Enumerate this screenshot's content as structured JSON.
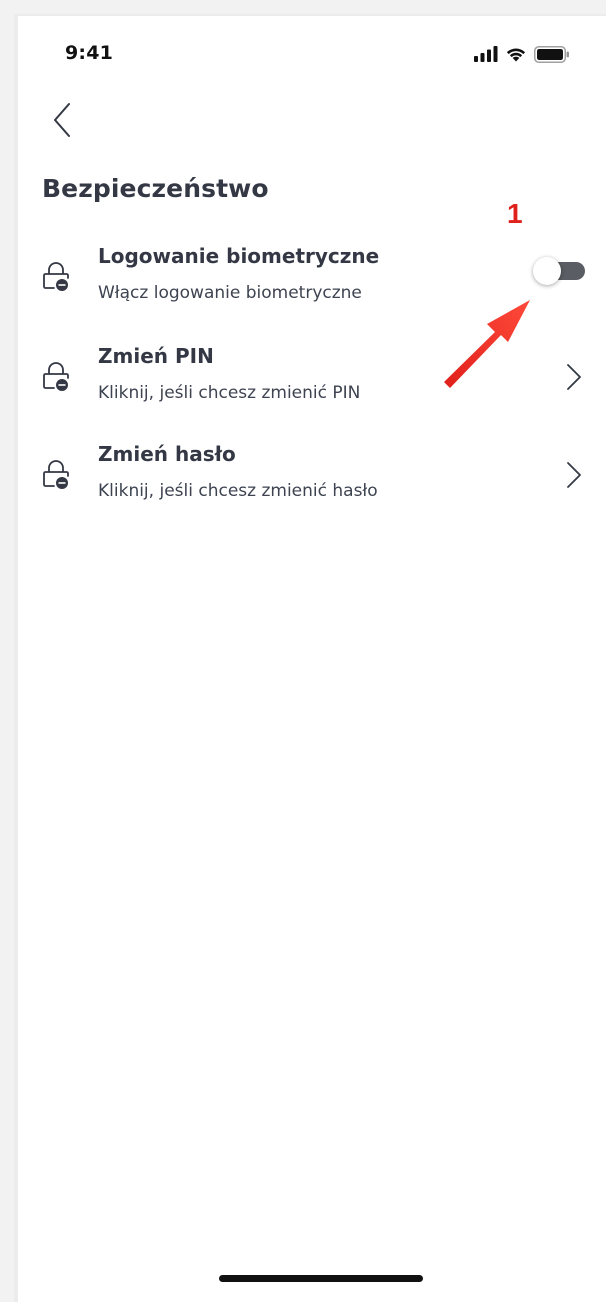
{
  "status_bar": {
    "time": "9:41",
    "icons": [
      "cellular-signal-icon",
      "wifi-icon",
      "battery-icon"
    ]
  },
  "nav": {
    "back_icon": "chevron-left-icon"
  },
  "page": {
    "title": "Bezpieczeństwo"
  },
  "settings": {
    "items": [
      {
        "title": "Logowanie biometryczne",
        "subtitle": "Włącz logowanie biometryczne",
        "icon": "lock-icon",
        "control": "toggle",
        "toggle_on": false
      },
      {
        "title": "Zmień PIN",
        "subtitle": "Kliknij, jeśli chcesz zmienić PIN",
        "icon": "lock-icon",
        "control": "chevron-right-icon"
      },
      {
        "title": "Zmień hasło",
        "subtitle": "Kliknij, jeśli chcesz zmienić hasło",
        "icon": "lock-icon",
        "control": "chevron-right-icon"
      }
    ]
  },
  "annotation": {
    "number": "1",
    "color": "#e0201b"
  },
  "colors": {
    "text_primary": "#333844",
    "toggle_track_off": "#5a5d63",
    "background": "#ffffff"
  }
}
